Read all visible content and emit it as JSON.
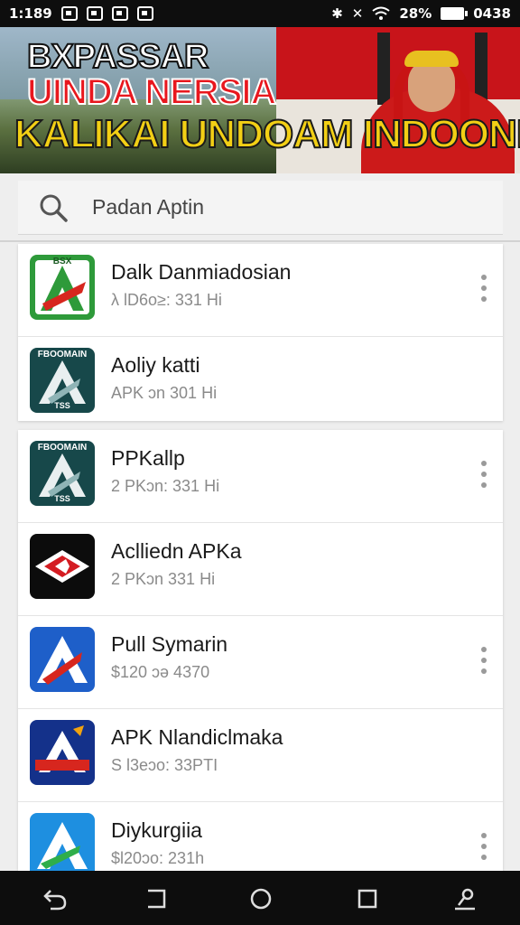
{
  "status_bar": {
    "time": "1:189",
    "right_text": "28%",
    "clock_right": "0438",
    "icons": [
      "image-icon",
      "gallery-icon",
      "mail-icon",
      "photo-icon",
      "bluetooth-icon",
      "mute-icon",
      "wifi-icon",
      "battery-icon"
    ]
  },
  "banner": {
    "line1": "BXPASSAR",
    "line2": "UINDA NERSIA",
    "line3": "KALIKAI UNDOAM INDOONESIA\"",
    "colors": {
      "red": "#c8141a",
      "yellow": "#f2cf15",
      "white": "#ffffff"
    }
  },
  "search": {
    "placeholder": "Padan Aptin"
  },
  "apps": [
    {
      "title": "Dalk Danmiadosian",
      "subtitle": "λ lD6o≥: 331 Hi",
      "icon": "green-a-logo",
      "icon_label": "BSX",
      "has_menu": true
    },
    {
      "title": "Aoliy katti",
      "subtitle": "APK ɔn 301 Hi",
      "icon": "teal-a-logo",
      "icon_label": "FBOOMAIN",
      "icon_label_bottom": "TSS",
      "has_menu": false
    },
    {
      "title": "PPKallp",
      "subtitle": "2 PKɔn: 331 Hi",
      "icon": "teal-a-logo",
      "icon_label": "FBOOMAIN",
      "icon_label_bottom": "TSS",
      "has_menu": true
    },
    {
      "title": "Aclliedn APKa",
      "subtitle": "2 PKɔn 331 Hi",
      "icon": "black-diamond-logo",
      "icon_label": "",
      "has_menu": false
    },
    {
      "title": "Pull Symarin",
      "subtitle": "$120 ɔə 4370",
      "icon": "blue-a-logo",
      "icon_label": "",
      "has_menu": true
    },
    {
      "title": "APK Nlandiclmaka",
      "subtitle": "S l3eɔo: 33PTI",
      "icon": "navy-a-logo",
      "icon_label": "",
      "has_menu": false
    },
    {
      "title": "Diykurgiia",
      "subtitle": "$l20ɔo: 231h",
      "icon": "sky-a-logo",
      "icon_label": "",
      "has_menu": true
    }
  ],
  "nav": {
    "buttons": [
      "back-icon",
      "recent-apps-icon",
      "home-icon",
      "overview-icon",
      "assistant-icon"
    ]
  }
}
